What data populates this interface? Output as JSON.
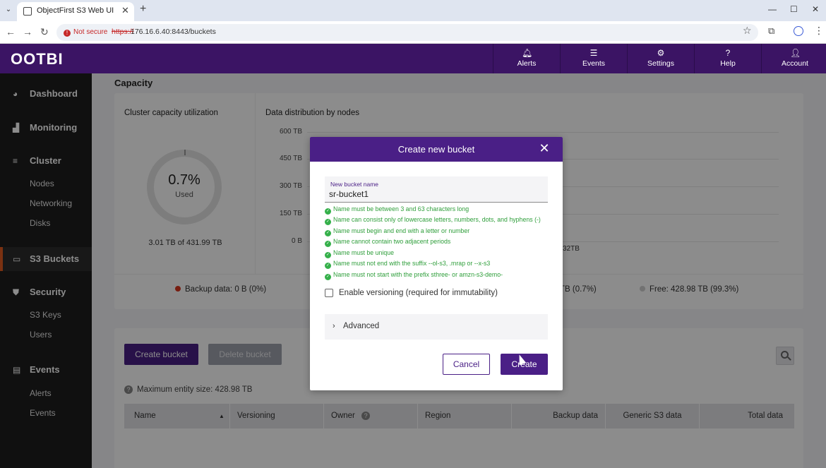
{
  "browser": {
    "tab_title": "ObjectFirst S3 Web UI",
    "tab_close": "✕",
    "new_tab": "+",
    "not_secure": "Not secure",
    "url_scheme": "https://",
    "url_rest": "176.16.6.40:8443/buckets"
  },
  "header": {
    "logo": "OOTBI",
    "items": [
      {
        "label": "Alerts",
        "icon": "bell-icon"
      },
      {
        "label": "Events",
        "icon": "list-icon"
      },
      {
        "label": "Settings",
        "icon": "gear-icon"
      },
      {
        "label": "Help",
        "icon": "help-icon"
      },
      {
        "label": "Account",
        "icon": "user-icon"
      }
    ]
  },
  "sidebar": {
    "sections": [
      {
        "label": "Dashboard",
        "icon": "dashboard-icon"
      },
      {
        "label": "Monitoring",
        "icon": "chart-icon"
      },
      {
        "label": "Cluster",
        "icon": "server-icon",
        "items": [
          "Nodes",
          "Networking",
          "Disks"
        ]
      },
      {
        "label": "S3 Buckets",
        "icon": "bucket-icon",
        "active": true
      },
      {
        "label": "Security",
        "icon": "shield-icon",
        "items": [
          "S3 Keys",
          "Users"
        ]
      },
      {
        "label": "Events",
        "icon": "events-icon",
        "items": [
          "Alerts",
          "Events"
        ]
      }
    ],
    "active_color": "#e05a1f"
  },
  "capacity": {
    "section_title": "Capacity",
    "utilization_title": "Cluster capacity utilization",
    "utilization_value": "0.7%",
    "utilization_sub": "Used",
    "utilization_total": "3.01 TB of 431.99 TB",
    "distribution_title": "Data distribution by nodes",
    "y_ticks": [
      "600 TB",
      "450 TB",
      "300 TB",
      "150 TB",
      "0 B"
    ],
    "partial_value": "32TB",
    "legend": {
      "backup": "Backup data: 0 B (0%)",
      "partial": "TB (0.7%)",
      "free": "Free: 428.98 TB (99.3%)"
    },
    "backup_color": "#d9361e",
    "free_color": "#cfcfcf"
  },
  "buckets": {
    "create_button": "Create bucket",
    "delete_button": "Delete bucket",
    "max_entity": "Maximum entity size:  428.98 TB",
    "columns": [
      "Name",
      "Versioning",
      "Owner",
      "Region",
      "Backup data",
      "Generic S3 data",
      "Total data"
    ]
  },
  "modal": {
    "title": "Create new bucket",
    "field_label": "New bucket name",
    "field_value": "sr-bucket1",
    "rules": [
      "Name must be between 3 and 63 characters long",
      "Name can consist only of lowercase letters, numbers, dots, and hyphens (-)",
      "Name must begin and end with a letter or number",
      "Name cannot contain two adjacent periods",
      "Name must be unique",
      "Name must not end with the suffix --ol-s3, .mrap or --x-s3",
      "Name must not start with the prefix sthree- or amzn-s3-demo-"
    ],
    "versioning_label": "Enable versioning (required for immutability)",
    "advanced_label": "Advanced",
    "cancel_button": "Cancel",
    "create_button": "Create",
    "accent_color": "#4a1f86",
    "rule_color": "#2e9e3a"
  }
}
